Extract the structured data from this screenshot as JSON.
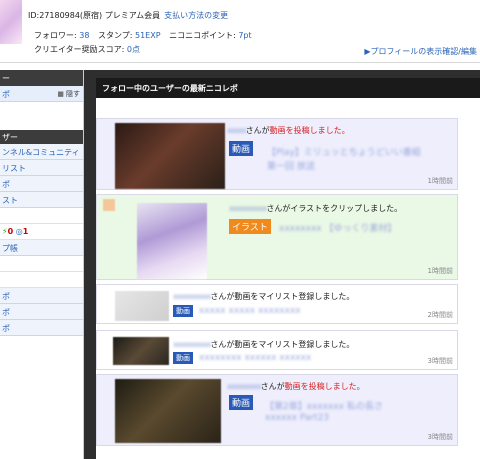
{
  "header": {
    "user_id": "ID:27180984(原宿) プレミアム会員",
    "payment_change_link": "支払い方法の変更",
    "followers_label": "フォロワー:",
    "followers_value": "38",
    "stamps_label": "スタンプ:",
    "stamps_value": "51EXP",
    "points_label": "ニコニコポイント:",
    "points_value": "7pt",
    "creator_label": "クリエイター奨励スコア:",
    "creator_value": "0点",
    "profile_link": "▶プロフィールの表示確認/編集"
  },
  "sidebar": {
    "header": "ー",
    "sub_item": "ポ",
    "sub_hide": "隠す",
    "section2_header": "ザー",
    "items": [
      "ンネル&コミュニティ",
      "リスト",
      "ポ",
      "スト"
    ],
    "icons_row": {
      "red_count": "0",
      "blue_count": "1"
    },
    "item_after": "プ帳",
    "tail_items": [
      "ポ",
      "ポ",
      "ポ"
    ]
  },
  "main": {
    "title": "フォロー中のユーザーの最新ニコレポ",
    "feed": [
      {
        "name": "xxxxx",
        "action": "さんが",
        "highlight": "動画を投稿しました。",
        "badge": "動画",
        "badge_color": "#2a5ab8",
        "title_line1": "【Play】ミリュッとちょうどいい番組",
        "title_line2": "第一回 放送",
        "ago": "1時間前",
        "bg": "#eeeefc"
      },
      {
        "name": "xxxxxxxxxx",
        "action": "さんがイラストをクリップしました。",
        "highlight": "",
        "badge": "イラスト",
        "badge_color": "#f08a1c",
        "title_line1": "xxxxxxxx 【ゆっくり素材】",
        "title_line2": "",
        "ago": "1時間前",
        "bg": "#eaf8e6"
      },
      {
        "name": "xxxxxxxxxx",
        "action": "さんが動画をマイリスト登録しました。",
        "highlight": "",
        "badge": "動画",
        "badge_color": "#2a5ab8",
        "title_line1": "xxxxx xxxxx xxxxxxxx",
        "title_line2": "",
        "ago": "2時間前",
        "bg": "#ffffff"
      },
      {
        "name": "xxxxxxxxxx",
        "action": "さんが動画をマイリスト登録しました。",
        "highlight": "",
        "badge": "動画",
        "badge_color": "#2a5ab8",
        "title_line1": "xxxxxxxx xxxxxx xxxxxx",
        "title_line2": "",
        "ago": "3時間前",
        "bg": "#ffffff"
      },
      {
        "name": "xxxxxxxxx",
        "action": "さんが",
        "highlight": "動画を投稿しました。",
        "badge": "動画",
        "badge_color": "#2a5ab8",
        "title_line1": "【第2章】xxxxxxx 私の長さ",
        "title_line2": "xxxxxx Part23",
        "ago": "3時間前",
        "bg": "#eeeefc"
      }
    ]
  }
}
